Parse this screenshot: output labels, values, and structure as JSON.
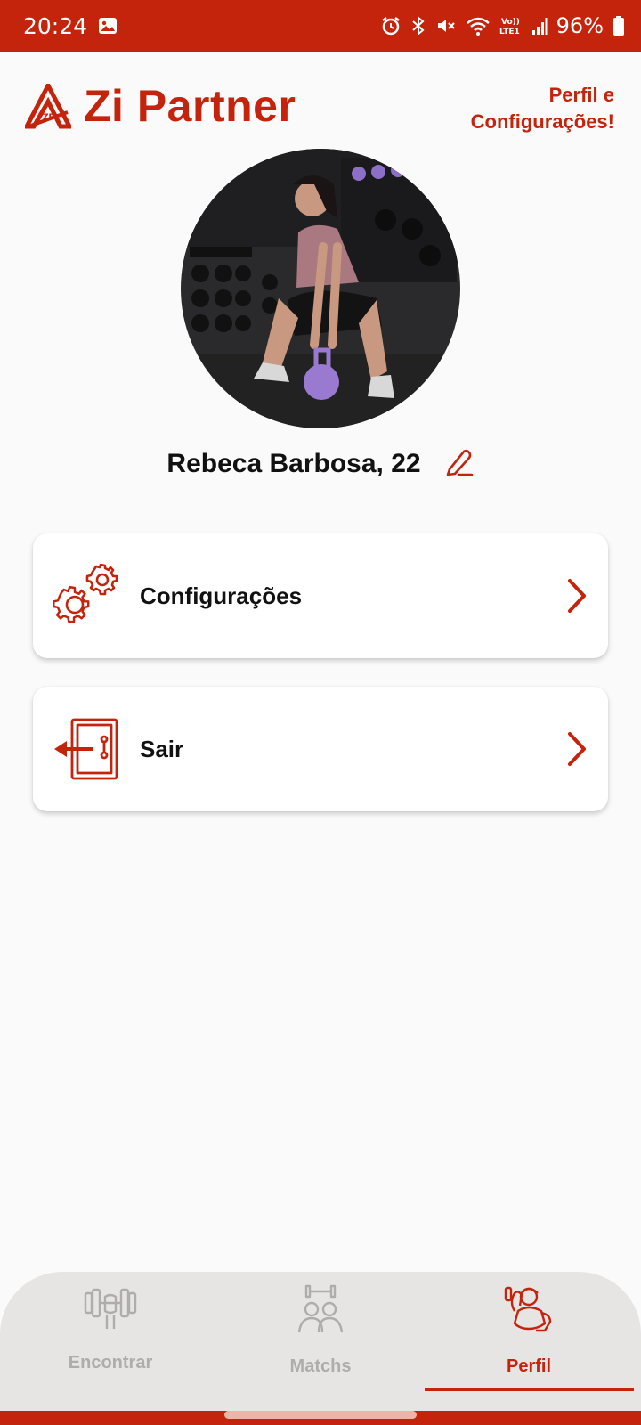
{
  "status_bar": {
    "time": "20:24",
    "battery": "96%",
    "icons": [
      "image-icon",
      "alarm-icon",
      "bluetooth-icon",
      "mute-icon",
      "wifi-icon",
      "volte-icon",
      "signal-icon",
      "battery-icon"
    ]
  },
  "header": {
    "app_name": "Zi Partner",
    "logo_letters": "ZP",
    "section_link": "Perfil e Configurações!"
  },
  "profile": {
    "name": "Rebeca Barbosa, 22"
  },
  "menu": [
    {
      "label": "Configurações",
      "icon": "gears-icon"
    },
    {
      "label": "Sair",
      "icon": "door-exit-icon"
    }
  ],
  "bottom_nav": {
    "items": [
      {
        "label": "Encontrar",
        "icon": "dumbbell-icon",
        "active": false
      },
      {
        "label": "Matchs",
        "icon": "partners-icon",
        "active": false
      },
      {
        "label": "Perfil",
        "icon": "athlete-icon",
        "active": true
      }
    ]
  },
  "colors": {
    "accent": "#c4240c",
    "background": "#fafafa",
    "nav_background": "#e7e4e4",
    "inactive": "#b0acac"
  }
}
